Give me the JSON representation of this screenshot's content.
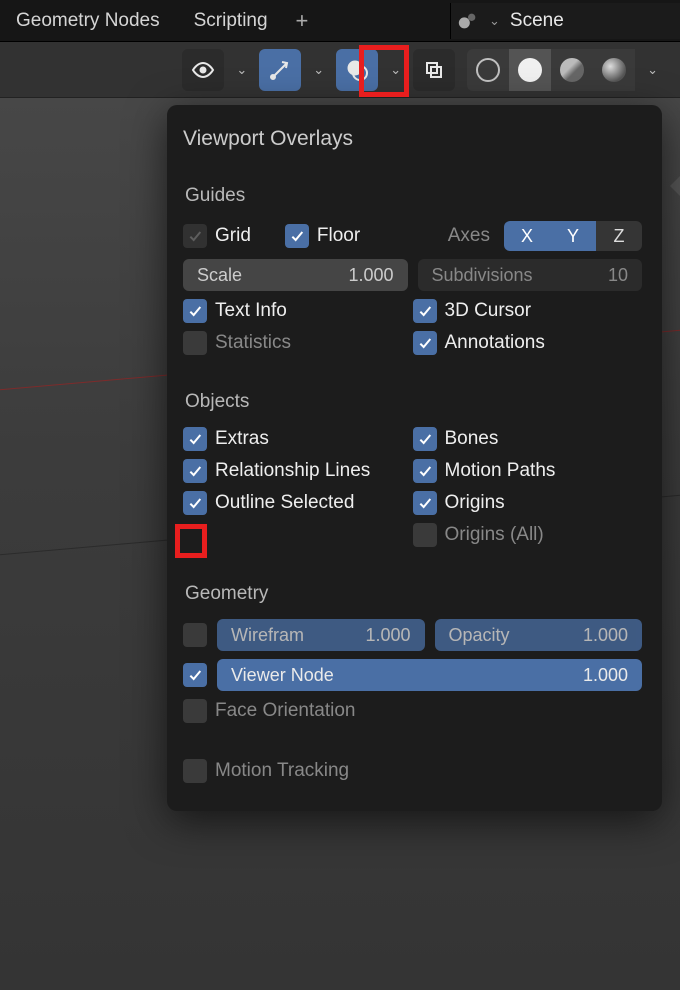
{
  "tabs": {
    "t1": "Geometry Nodes",
    "t2": "Scripting"
  },
  "scene": {
    "label": "Scene"
  },
  "panel": {
    "title": "Viewport Overlays",
    "guides": {
      "title": "Guides",
      "grid": "Grid",
      "floor": "Floor",
      "axes": "Axes",
      "axis_x": "X",
      "axis_y": "Y",
      "axis_z": "Z",
      "scale_label": "Scale",
      "scale_value": "1.000",
      "subdiv_label": "Subdivisions",
      "subdiv_value": "10",
      "textinfo": "Text Info",
      "cursor": "3D Cursor",
      "stats": "Statistics",
      "annot": "Annotations"
    },
    "objects": {
      "title": "Objects",
      "extras": "Extras",
      "bones": "Bones",
      "rel": "Relationship Lines",
      "motion": "Motion Paths",
      "outline": "Outline Selected",
      "origins": "Origins",
      "origins_all": "Origins (All)"
    },
    "geometry": {
      "title": "Geometry",
      "wire_label": "Wirefram",
      "wire_value": "1.000",
      "opacity_label": "Opacity",
      "opacity_value": "1.000",
      "viewer_label": "Viewer Node",
      "viewer_value": "1.000",
      "faceori": "Face Orientation"
    },
    "motion_tracking": "Motion Tracking"
  }
}
